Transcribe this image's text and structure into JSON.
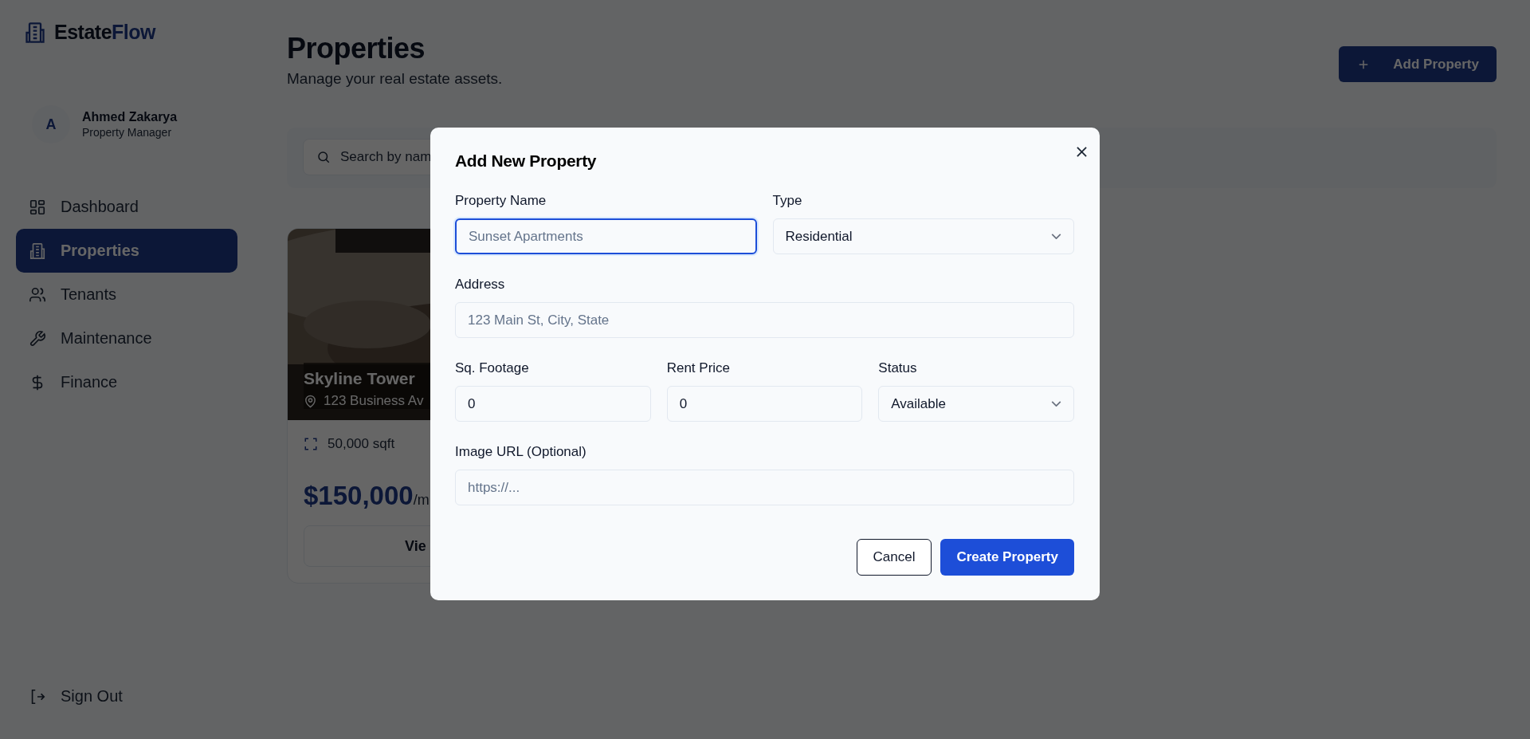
{
  "brand": {
    "first": "Estate",
    "second": "Flow"
  },
  "user": {
    "initial": "A",
    "name": "Ahmed Zakarya",
    "role": "Property Manager"
  },
  "nav": [
    {
      "label": "Dashboard",
      "selected": false
    },
    {
      "label": "Properties",
      "selected": true
    },
    {
      "label": "Tenants",
      "selected": false
    },
    {
      "label": "Maintenance",
      "selected": false
    },
    {
      "label": "Finance",
      "selected": false
    }
  ],
  "sign_out": "Sign Out",
  "header": {
    "title": "Properties",
    "subtitle": "Manage your real estate assets.",
    "add_button": "Add Property"
  },
  "search": {
    "placeholder": "Search by nam"
  },
  "card": {
    "kind": "picture",
    "name": "Skyline Tower",
    "address": "123 Business Av",
    "area": "50,000 sqft",
    "price": "$150,000",
    "unit": "/m",
    "button": "Vie"
  },
  "modal": {
    "title": "Add New Property",
    "rows": [
      [
        {
          "label": "Property Name",
          "kind": "input",
          "placeholder": "Sunset Apartments",
          "focused": true
        },
        {
          "label": "Type",
          "kind": "select",
          "value": "Residential",
          "focused": false
        }
      ],
      [
        {
          "label": "Address",
          "kind": "input",
          "placeholder": "123 Main St, City, State",
          "focused": false
        }
      ],
      [
        {
          "label": "Sq. Footage",
          "kind": "input",
          "value": "0",
          "focused": false
        },
        {
          "label": "Rent Price",
          "kind": "input",
          "value": "0",
          "focused": false
        },
        {
          "label": "Status",
          "kind": "select",
          "value": "Available",
          "focused": false
        }
      ],
      [
        {
          "label": "Image URL (Optional)",
          "kind": "input",
          "placeholder": "https://...",
          "focused": false
        }
      ]
    ],
    "cancel": "Cancel",
    "submit": "Create Property"
  }
}
